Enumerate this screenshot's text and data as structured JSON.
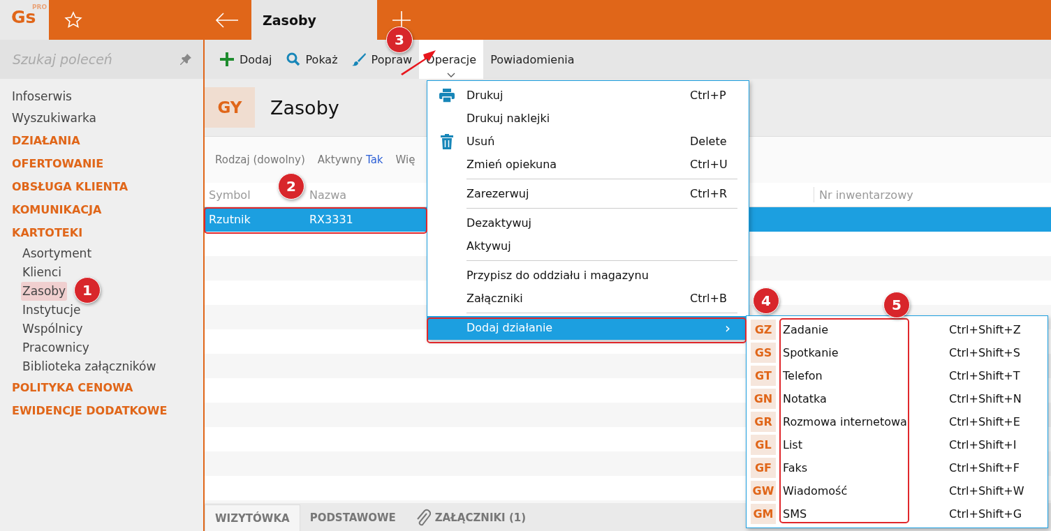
{
  "app": {
    "logo": "Gs",
    "logo_badge": "PRO"
  },
  "tabs": [
    {
      "label": "Zasoby",
      "selected": true
    }
  ],
  "sidebar": {
    "search": {
      "placeholder": "Szukaj poleceń"
    },
    "items": [
      {
        "label": "Infoserwis",
        "kind": "link"
      },
      {
        "label": "Wyszukiwarka",
        "kind": "link"
      },
      {
        "label": "DZIAŁANIA",
        "kind": "section"
      },
      {
        "label": "OFERTOWANIE",
        "kind": "section"
      },
      {
        "label": "OBSŁUGA KLIENTA",
        "kind": "section"
      },
      {
        "label": "KOMUNIKACJA",
        "kind": "section"
      },
      {
        "label": "KARTOTEKI",
        "kind": "section",
        "children": [
          {
            "label": "Asortyment",
            "selected": false
          },
          {
            "label": "Klienci",
            "selected": false
          },
          {
            "label": "Zasoby",
            "selected": true
          },
          {
            "label": "Instytucje",
            "selected": false
          },
          {
            "label": "Wspólnicy",
            "selected": false
          },
          {
            "label": "Pracownicy",
            "selected": false
          },
          {
            "label": "Biblioteka załączników",
            "selected": false
          }
        ]
      },
      {
        "label": "POLITYKA CENOWA",
        "kind": "section"
      },
      {
        "label": "EWIDENCJE DODATKOWE",
        "kind": "section"
      }
    ]
  },
  "toolbar": [
    {
      "label": "Dodaj",
      "expanded": false
    },
    {
      "label": "Pokaż",
      "expanded": false
    },
    {
      "label": "Popraw",
      "expanded": false
    },
    {
      "label": "Operacje",
      "expanded": true
    },
    {
      "label": "Powiadomienia",
      "expanded": false
    }
  ],
  "header": {
    "badge": "GY",
    "title": "Zasoby"
  },
  "filters": [
    {
      "label": "Rodzaj (dowolny)"
    },
    {
      "label": "Aktywny",
      "value": "Tak"
    },
    {
      "label": "Wię"
    }
  ],
  "table": {
    "columns": [
      "Symbol",
      "Nazwa",
      "Nr inwentarzowy"
    ],
    "rows": [
      {
        "cells": [
          "Rzutnik",
          "RX3331"
        ],
        "selected": true
      }
    ]
  },
  "bottom_tabs": [
    {
      "label": "WIZYTÓWKA",
      "selected": true
    },
    {
      "label": "PODSTAWOWE",
      "selected": false
    },
    {
      "label": "ZAŁĄCZNIKI (1)",
      "selected": false
    }
  ],
  "context_menu": [
    {
      "kind": "item",
      "label": "Drukuj",
      "shortcut": "Ctrl+P",
      "highlighted": false
    },
    {
      "kind": "item",
      "label": "Drukuj naklejki",
      "highlighted": false
    },
    {
      "kind": "item",
      "label": "Usuń",
      "shortcut": "Delete",
      "highlighted": false
    },
    {
      "kind": "item",
      "label": "Zmień opiekuna",
      "shortcut": "Ctrl+U",
      "highlighted": false
    },
    {
      "kind": "separator"
    },
    {
      "kind": "item",
      "label": "Zarezerwuj",
      "shortcut": "Ctrl+R",
      "highlighted": false
    },
    {
      "kind": "separator"
    },
    {
      "kind": "item",
      "label": "Dezaktywuj",
      "highlighted": false
    },
    {
      "kind": "item",
      "label": "Aktywuj",
      "highlighted": false
    },
    {
      "kind": "separator"
    },
    {
      "kind": "item",
      "label": "Przypisz do oddziału i magazynu",
      "highlighted": false
    },
    {
      "kind": "item",
      "label": "Załączniki",
      "shortcut": "Ctrl+B",
      "highlighted": false
    },
    {
      "kind": "separator"
    },
    {
      "kind": "item",
      "label": "Dodaj działanie",
      "submenu": "›",
      "highlighted": true
    }
  ],
  "submenu": [
    {
      "code": "GZ",
      "label": "Zadanie",
      "shortcut": "Ctrl+Shift+Z"
    },
    {
      "code": "GS",
      "label": "Spotkanie",
      "shortcut": "Ctrl+Shift+S"
    },
    {
      "code": "GT",
      "label": "Telefon",
      "shortcut": "Ctrl+Shift+T"
    },
    {
      "code": "GN",
      "label": "Notatka",
      "shortcut": "Ctrl+Shift+N"
    },
    {
      "code": "GR",
      "label": "Rozmowa internetowa",
      "shortcut": "Ctrl+Shift+E"
    },
    {
      "code": "GL",
      "label": "List",
      "shortcut": "Ctrl+Shift+I"
    },
    {
      "code": "GF",
      "label": "Faks",
      "shortcut": "Ctrl+Shift+F"
    },
    {
      "code": "GW",
      "label": "Wiadomość",
      "shortcut": "Ctrl+Shift+W"
    },
    {
      "code": "GM",
      "label": "SMS",
      "shortcut": "Ctrl+Shift+G"
    }
  ],
  "annotations": [
    {
      "label": "1"
    },
    {
      "label": "2"
    },
    {
      "label": "3"
    },
    {
      "label": "4"
    },
    {
      "label": "5"
    }
  ]
}
